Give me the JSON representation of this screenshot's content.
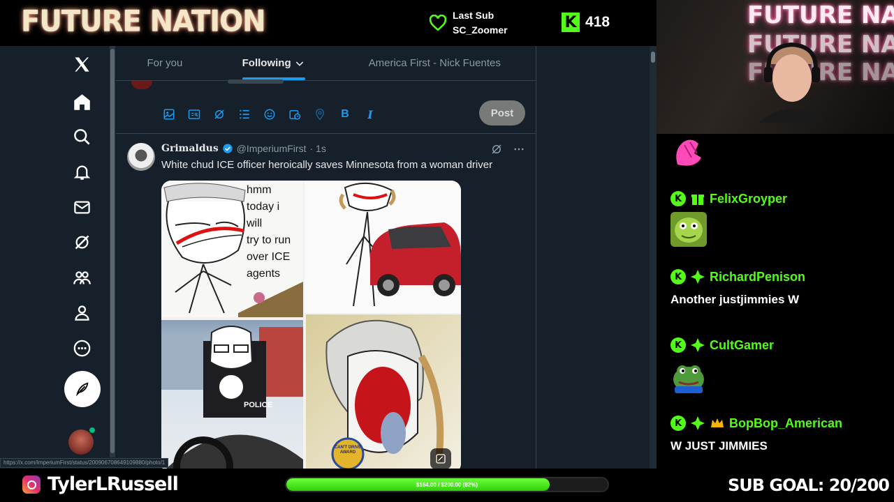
{
  "overlay": {
    "logo": "FUTURE NATION",
    "last_sub_label": "Last Sub",
    "last_sub_user": "SC_Zoomer",
    "kick_viewers": "418",
    "kick_letter": "K",
    "instagram_handle": "TylerLRussell",
    "goal_progress_text": "$164.00 / $200.00 (82%)",
    "goal_fraction": 0.82,
    "sub_goal": "SUB GOAL: 20/200",
    "webcam_neon": "FUTURE NATION"
  },
  "twitter": {
    "tabs": [
      {
        "label": "For you",
        "active": false
      },
      {
        "label": "Following",
        "active": true
      },
      {
        "label": "America First - Nick Fuentes",
        "active": false
      }
    ],
    "nav_icons": [
      "x-logo-icon",
      "home-icon",
      "search-icon",
      "bell-icon",
      "mail-icon",
      "grok-icon",
      "communities-icon",
      "profile-icon",
      "more-icon"
    ],
    "composer": {
      "post_label": "Post",
      "tools": [
        "image-icon",
        "gif-icon",
        "grok-icon",
        "poll-icon",
        "emoji-icon",
        "schedule-icon",
        "location-icon",
        "bold-icon",
        "italic-icon"
      ],
      "bold": "B",
      "italic": "I"
    },
    "tweet": {
      "name": "Grimaldus",
      "handle": "@ImperiumFirst",
      "time": "· 1s",
      "text": "White chud ICE officer heroically saves Minnesota from a woman driver",
      "meme_lines": [
        "hmm",
        "today i",
        "will",
        "try to run",
        "over ICE",
        "agents"
      ],
      "police_text": "POLICE",
      "award_text": "CAN'T DRIVE AWARD"
    },
    "status_url": "https://x.com/ImperiumFirst/status/2009067086491098​80/photo/1"
  },
  "chat": {
    "messages": [
      {
        "user": "",
        "text": "",
        "emote": "pink-hand-emote"
      },
      {
        "user": "FelixGroyper",
        "text": "",
        "emote": "green-face-emote"
      },
      {
        "user": "RichardPenison",
        "text": "Another justjimmies W"
      },
      {
        "user": "CultGamer",
        "text": "",
        "emote": "pepe-emote"
      },
      {
        "user": "BopBop_American",
        "text": "W JUST JIMMIES"
      }
    ]
  },
  "colors": {
    "kick_green": "#53fc18",
    "twitter_bg": "#15202b",
    "twitter_blue": "#1d9bf0"
  }
}
